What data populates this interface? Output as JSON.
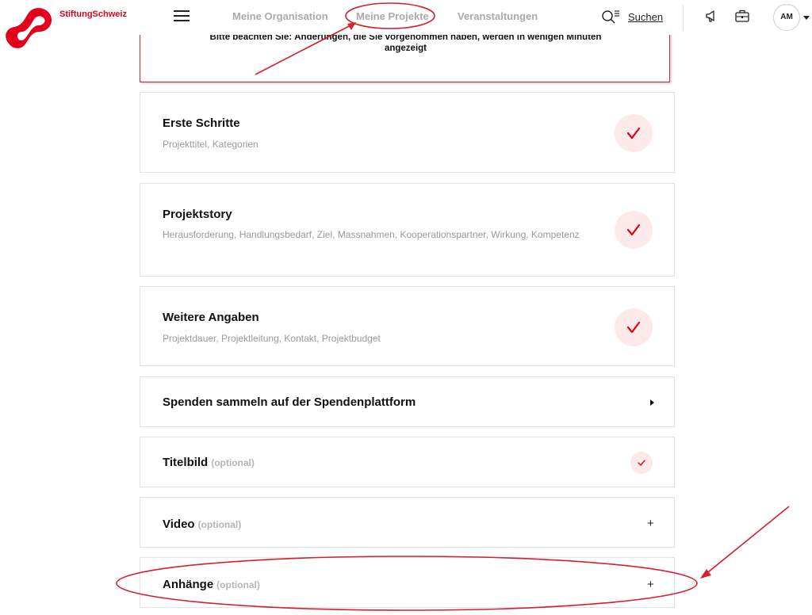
{
  "brand": {
    "name": "StiftungSchweiz",
    "color": "#e3001b"
  },
  "nav": {
    "items": [
      {
        "label": "Meine Organisation"
      },
      {
        "label": "Meine Projekte"
      },
      {
        "label": "Veranstaltungen"
      }
    ],
    "search_label": "Suchen",
    "avatar_initials": "AM"
  },
  "notice": {
    "line1": "Bitte beachten Sie: Änderungen, die Sie vorgenommen haben, werden in wenigen Minuten",
    "line2": "angezeigt"
  },
  "sections": [
    {
      "title": "Erste Schritte",
      "subtitle": "Projekttitel, Kategorien",
      "status": "check-icon"
    },
    {
      "title": "Projektstory",
      "subtitle": "Herausforderung, Handlungsbedarf, Ziel, Massnahmen, Kooperationspartner, Wirkung, Kompetenz",
      "status": "check-icon"
    },
    {
      "title": "Weitere Angaben",
      "subtitle": "Projektdauer, Projektleitung, Kontakt, Projektbudget",
      "status": "check-icon"
    },
    {
      "title": "Spenden sammeln auf der Spendenplattform",
      "status": "caret-right-icon"
    },
    {
      "title": "Titelbild",
      "optional": "(optional)",
      "status": "check-icon"
    },
    {
      "title": "Video",
      "optional": "(optional)",
      "status": "plus-icon",
      "plus": "+"
    },
    {
      "title": "Anhänge",
      "optional": "(optional)",
      "status": "plus-icon",
      "plus": "+"
    }
  ],
  "colors": {
    "accent": "#e3001b",
    "check_bg": "#fceaea",
    "annotation": "#d5202d"
  }
}
